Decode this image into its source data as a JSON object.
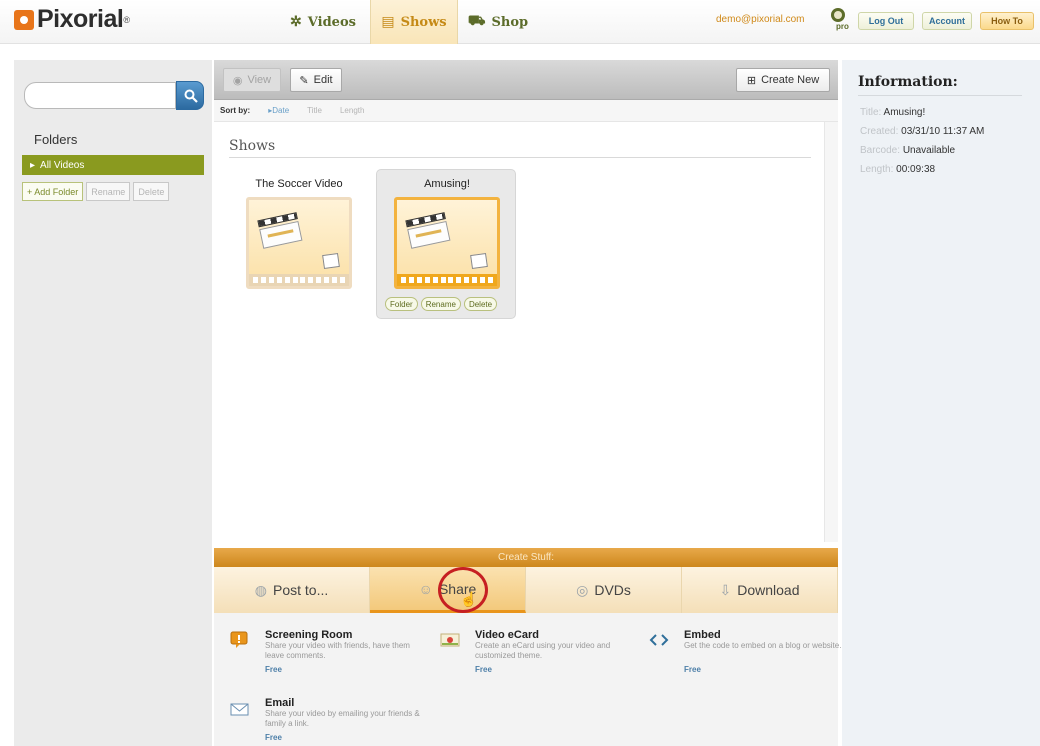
{
  "header": {
    "logo": "Pixorial",
    "logo_mark": "®",
    "nav": [
      {
        "label": "Videos",
        "icon": "reel-icon"
      },
      {
        "label": "Shows",
        "icon": "clapper-icon"
      },
      {
        "label": "Shop",
        "icon": "cart-icon"
      }
    ],
    "active_nav": "Shows",
    "user_email": "demo@pixorial.com",
    "pro_badge": "pro",
    "buttons": {
      "logout": "Log Out",
      "account": "Account",
      "howto": "How To"
    }
  },
  "sidebar": {
    "search": {
      "value": "",
      "placeholder": ""
    },
    "folders_title": "Folders",
    "active_folder": "All Videos",
    "actions": {
      "add": "+ Add Folder",
      "rename": "Rename",
      "delete": "Delete"
    }
  },
  "toolbar": {
    "view": "View",
    "edit": "Edit",
    "create_new": "Create New"
  },
  "sort": {
    "label": "Sort by:",
    "options": [
      "Date",
      "Title",
      "Length"
    ],
    "active": "Date"
  },
  "main": {
    "section_title": "Shows",
    "shows": [
      {
        "title": "The Soccer Video",
        "selected": false
      },
      {
        "title": "Amusing!",
        "selected": true,
        "actions": [
          "Folder",
          "Rename",
          "Delete"
        ]
      }
    ]
  },
  "create": {
    "header": "Create Stuff:",
    "tabs": [
      {
        "label": "Post to...",
        "icon": "globe-icon"
      },
      {
        "label": "Share",
        "icon": "people-icon"
      },
      {
        "label": "DVDs",
        "icon": "disc-icon"
      },
      {
        "label": "Download",
        "icon": "download-arrow-icon"
      }
    ],
    "active_tab": "Share",
    "options": [
      {
        "title": "Screening Room",
        "desc": "Share your video with friends, have them leave comments.",
        "price": "Free"
      },
      {
        "title": "Video eCard",
        "desc": "Create an eCard using your video and customized theme.",
        "price": "Free"
      },
      {
        "title": "Embed",
        "desc": "Get the code to embed on a blog or website.",
        "price": "Free"
      },
      {
        "title": "Email",
        "desc": "Share your video by emailing your friends & family a link.",
        "price": "Free"
      }
    ]
  },
  "info": {
    "title": "Information:",
    "rows": [
      {
        "label": "Title:",
        "value": "Amusing!"
      },
      {
        "label": "Created:",
        "value": "03/31/10 11:37 AM"
      },
      {
        "label": "Barcode:",
        "value": "Unavailable"
      },
      {
        "label": "Length:",
        "value": "00:09:38"
      }
    ]
  },
  "colors": {
    "accent": "#e9951b",
    "brand_green": "#8a9a1f",
    "link_blue": "#2f6f9a",
    "highlight_red": "#c61f22"
  }
}
